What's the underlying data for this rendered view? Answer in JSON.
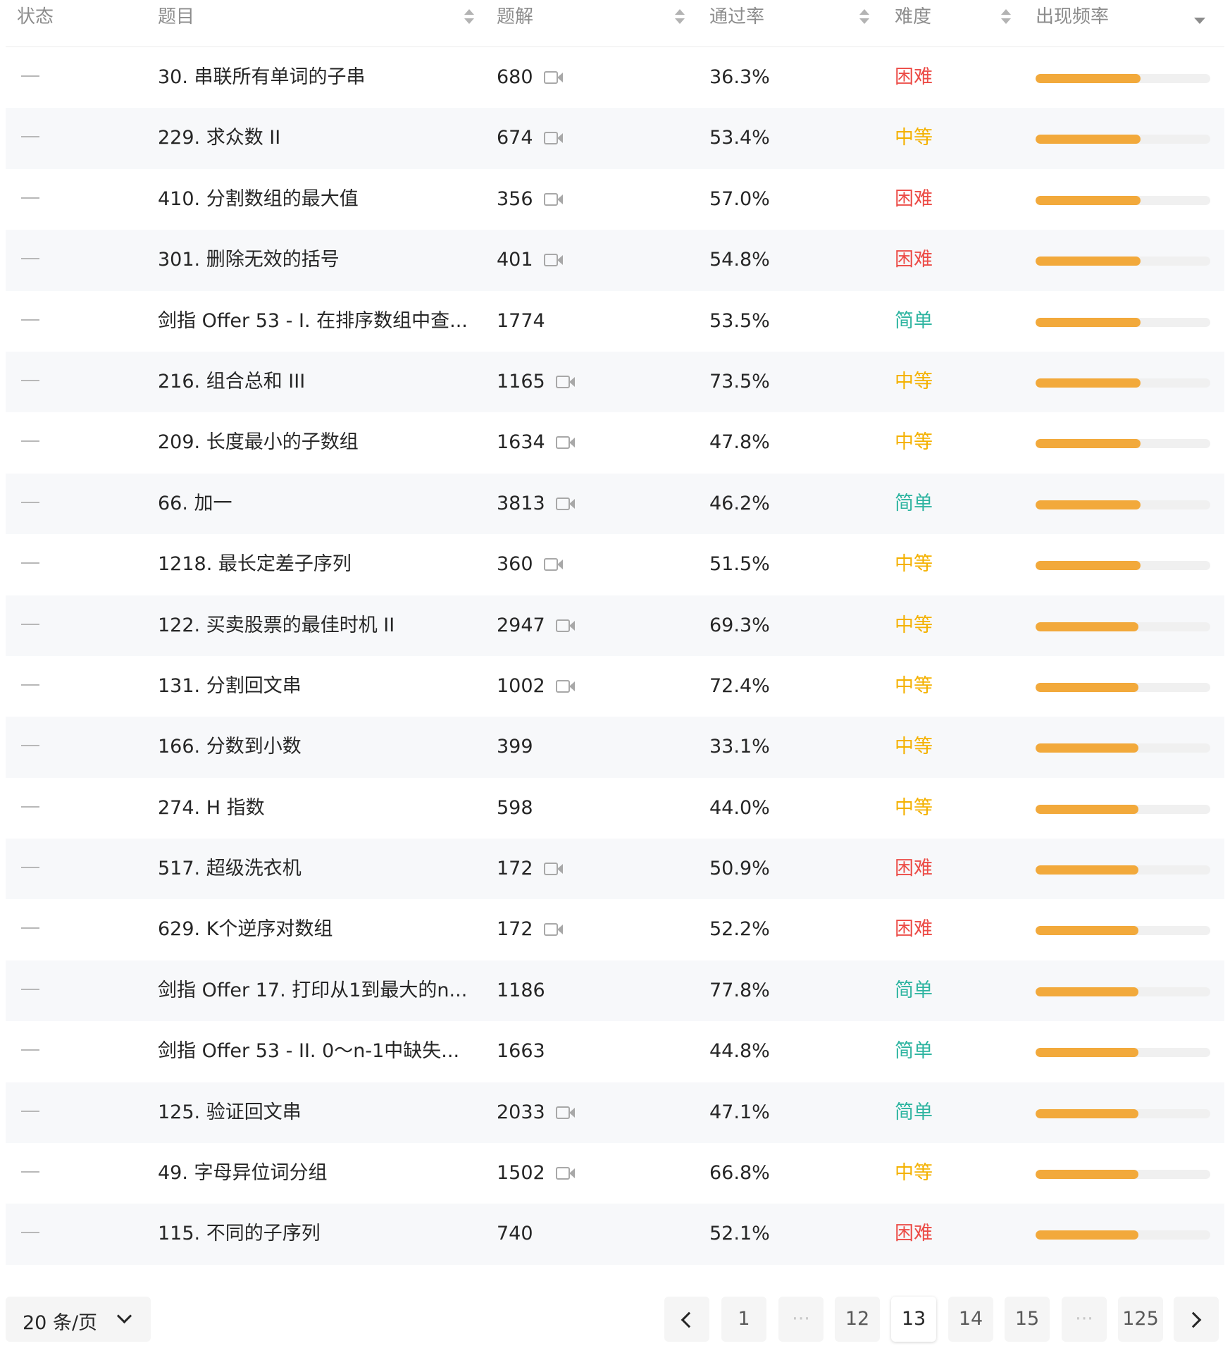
{
  "header": {
    "status": "状态",
    "title": "题目",
    "solutions": "题解",
    "pass_rate": "通过率",
    "difficulty": "难度",
    "frequency": "出现频率"
  },
  "colors": {
    "hard": "#ec4c47",
    "medium": "#f4b100",
    "easy": "#2db4a0",
    "frequency_bar": "#f2a93b"
  },
  "rows": [
    {
      "title": "30. 串联所有单词的子串",
      "solutions": "680",
      "video": true,
      "rate": "36.3%",
      "difficulty": "困难",
      "level": "hard",
      "freq": 0.6
    },
    {
      "title": "229. 求众数 II",
      "solutions": "674",
      "video": true,
      "rate": "53.4%",
      "difficulty": "中等",
      "level": "medium",
      "freq": 0.6
    },
    {
      "title": "410. 分割数组的最大值",
      "solutions": "356",
      "video": true,
      "rate": "57.0%",
      "difficulty": "困难",
      "level": "hard",
      "freq": 0.6
    },
    {
      "title": "301. 删除无效的括号",
      "solutions": "401",
      "video": true,
      "rate": "54.8%",
      "difficulty": "困难",
      "level": "hard",
      "freq": 0.6
    },
    {
      "title": "剑指 Offer 53 - I. 在排序数组中查...",
      "solutions": "1774",
      "video": false,
      "rate": "53.5%",
      "difficulty": "简单",
      "level": "easy",
      "freq": 0.6
    },
    {
      "title": "216. 组合总和 III",
      "solutions": "1165",
      "video": true,
      "rate": "73.5%",
      "difficulty": "中等",
      "level": "medium",
      "freq": 0.6
    },
    {
      "title": "209. 长度最小的子数组",
      "solutions": "1634",
      "video": true,
      "rate": "47.8%",
      "difficulty": "中等",
      "level": "medium",
      "freq": 0.6
    },
    {
      "title": "66. 加一",
      "solutions": "3813",
      "video": true,
      "rate": "46.2%",
      "difficulty": "简单",
      "level": "easy",
      "freq": 0.6
    },
    {
      "title": "1218. 最长定差子序列",
      "solutions": "360",
      "video": true,
      "rate": "51.5%",
      "difficulty": "中等",
      "level": "medium",
      "freq": 0.6
    },
    {
      "title": "122. 买卖股票的最佳时机 II",
      "solutions": "2947",
      "video": true,
      "rate": "69.3%",
      "difficulty": "中等",
      "level": "medium",
      "freq": 0.59
    },
    {
      "title": "131. 分割回文串",
      "solutions": "1002",
      "video": true,
      "rate": "72.4%",
      "difficulty": "中等",
      "level": "medium",
      "freq": 0.59
    },
    {
      "title": "166. 分数到小数",
      "solutions": "399",
      "video": false,
      "rate": "33.1%",
      "difficulty": "中等",
      "level": "medium",
      "freq": 0.59
    },
    {
      "title": "274. H 指数",
      "solutions": "598",
      "video": false,
      "rate": "44.0%",
      "difficulty": "中等",
      "level": "medium",
      "freq": 0.59
    },
    {
      "title": "517. 超级洗衣机",
      "solutions": "172",
      "video": true,
      "rate": "50.9%",
      "difficulty": "困难",
      "level": "hard",
      "freq": 0.59
    },
    {
      "title": "629. K个逆序对数组",
      "solutions": "172",
      "video": true,
      "rate": "52.2%",
      "difficulty": "困难",
      "level": "hard",
      "freq": 0.59
    },
    {
      "title": "剑指 Offer 17. 打印从1到最大的n...",
      "solutions": "1186",
      "video": false,
      "rate": "77.8%",
      "difficulty": "简单",
      "level": "easy",
      "freq": 0.59
    },
    {
      "title": "剑指 Offer 53 - II. 0～n-1中缺失...",
      "solutions": "1663",
      "video": false,
      "rate": "44.8%",
      "difficulty": "简单",
      "level": "easy",
      "freq": 0.59
    },
    {
      "title": "125. 验证回文串",
      "solutions": "2033",
      "video": true,
      "rate": "47.1%",
      "difficulty": "简单",
      "level": "easy",
      "freq": 0.59
    },
    {
      "title": "49. 字母异位词分组",
      "solutions": "1502",
      "video": true,
      "rate": "66.8%",
      "difficulty": "中等",
      "level": "medium",
      "freq": 0.59
    },
    {
      "title": "115. 不同的子序列",
      "solutions": "740",
      "video": false,
      "rate": "52.1%",
      "difficulty": "困难",
      "level": "hard",
      "freq": 0.59
    }
  ],
  "pagination": {
    "page_size": "20 条/页",
    "items": [
      {
        "label": "1",
        "type": "page",
        "active": false
      },
      {
        "label": "···",
        "type": "ellipsis",
        "active": false
      },
      {
        "label": "12",
        "type": "page",
        "active": false
      },
      {
        "label": "13",
        "type": "page",
        "active": true
      },
      {
        "label": "14",
        "type": "page",
        "active": false
      },
      {
        "label": "15",
        "type": "page",
        "active": false
      },
      {
        "label": "···",
        "type": "ellipsis",
        "active": false
      },
      {
        "label": "125",
        "type": "page",
        "active": false
      }
    ]
  }
}
